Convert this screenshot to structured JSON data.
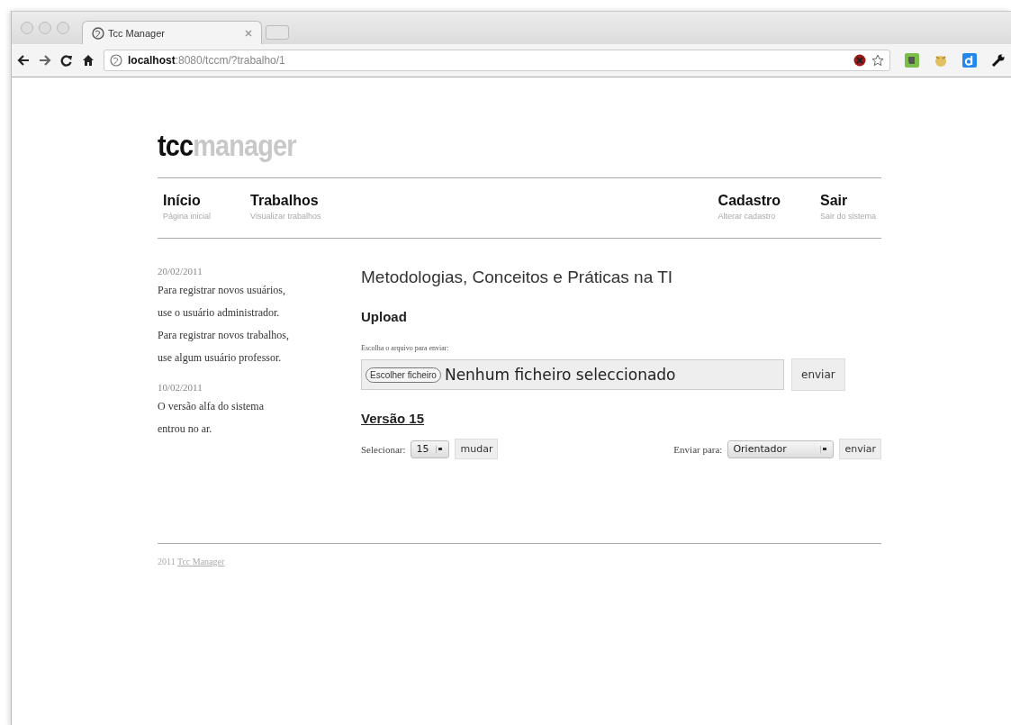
{
  "browser": {
    "tab_title": "Tcc Manager",
    "address_host": "localhost",
    "address_rest": ":8080/tccm/?trabalho/1"
  },
  "logo": {
    "part_1": "tcc",
    "part_2": "manager"
  },
  "nav_left": [
    {
      "title": "Início",
      "subtitle": "Página inicial"
    },
    {
      "title": "Trabalhos",
      "subtitle": "Visualizar trabalhos"
    }
  ],
  "nav_right": [
    {
      "title": "Cadastro",
      "subtitle": "Alterar cadastro"
    },
    {
      "title": "Sair",
      "subtitle": "Sair do sistema"
    }
  ],
  "news": [
    {
      "date": "20/02/2011",
      "text": "Para registrar novos usuários, use o usuário administrador. Para registrar novos trabalhos, use algum usuário professor."
    },
    {
      "date": "10/02/2011",
      "text": "O versão alfa do sistema entrou no ar."
    }
  ],
  "main": {
    "title": "Metodologias, Conceitos e Práticas na TI",
    "upload_heading": "Upload",
    "upload_label": "Escolha o arquivo para enviar:",
    "file_button": "Escolher ficheiro",
    "file_status": "Nenhum ficheiro seleccionado",
    "upload_submit": "enviar",
    "version_heading": "Versão 15",
    "select_label": "Selecionar:",
    "select_value": "15",
    "change_button": "mudar",
    "send_label": "Enviar para:",
    "send_value": "Orientador",
    "send_button": "enviar"
  },
  "footer": {
    "year": "2011",
    "link": "Tcc Manager"
  }
}
